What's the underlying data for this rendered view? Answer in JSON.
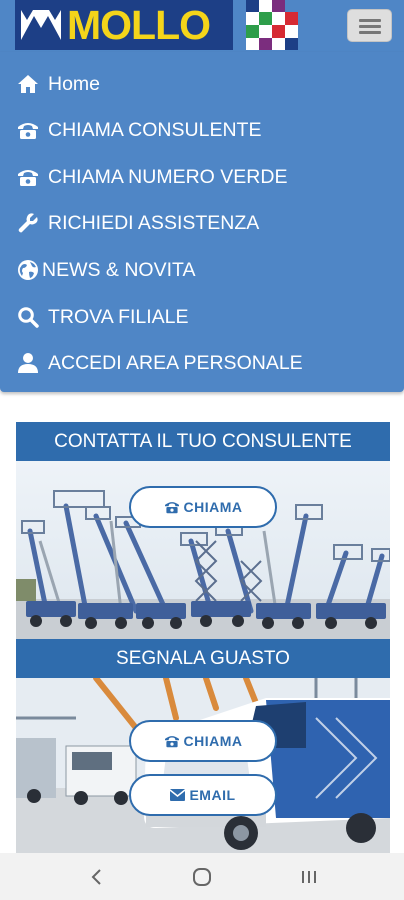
{
  "brand": {
    "logo_text": "MOLLO",
    "logo_bg": "#1d3f86",
    "logo_text_color": "#f4d51a"
  },
  "header": {
    "bg_color": "#4f86c6",
    "menu_button_icon": "hamburger-icon"
  },
  "nav": {
    "items": [
      {
        "label": "Home",
        "icon": "home-icon"
      },
      {
        "label": "CHIAMA CONSULENTE",
        "icon": "phone-icon"
      },
      {
        "label": "CHIAMA NUMERO VERDE",
        "icon": "phone-icon"
      },
      {
        "label": "RICHIEDI ASSISTENZA",
        "icon": "wrench-icon"
      },
      {
        "label": "NEWS & NOVITA",
        "icon": "globe-icon"
      },
      {
        "label": "TROVA FILIALE",
        "icon": "search-icon"
      },
      {
        "label": "ACCEDI AREA PERSONALE",
        "icon": "user-icon"
      }
    ]
  },
  "consultant": {
    "title": "CONTATTA IL TUO CONSULENTE",
    "call_button": "CHIAMA"
  },
  "fault": {
    "title": "SEGNALA GUASTO",
    "call_button": "CHIAMA",
    "email_button": "EMAIL"
  },
  "colors": {
    "accent": "#2f6cad",
    "menu_bg": "#4f86c6"
  },
  "system_nav": {
    "buttons": [
      "back-icon",
      "home-circle-icon",
      "recent-apps-icon"
    ]
  }
}
